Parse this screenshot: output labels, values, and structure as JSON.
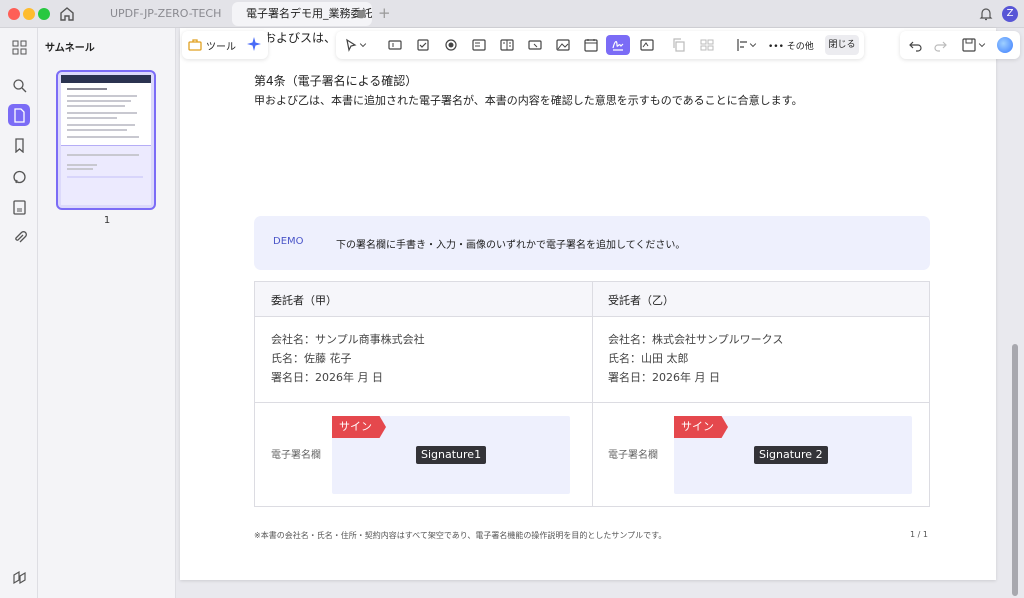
{
  "window": {
    "tabs": [
      {
        "label": "UPDF-JP-ZERO-TECH"
      },
      {
        "label": "電子署名デモ用_業務委託契約"
      }
    ],
    "avatar_initial": "Z"
  },
  "sidebar": {
    "panel_title": "サムネール",
    "thumbnail_page_number": "1"
  },
  "toolbar": {
    "tool_label": "ツール",
    "more_label": "その他",
    "close_label": "閉じる"
  },
  "document": {
    "clipped_heading": "およびスは、本",
    "article_title": "第4条（電子署名による確認）",
    "article_body": "甲および乙は、本書に追加された電子署名が、本書の内容を確認した意思を示すものであることに合意します。",
    "demo_label": "DEMO",
    "demo_text": "下の署名欄に手書き・入力・画像のいずれかで電子署名を追加してください。",
    "parties": [
      {
        "heading": "委託者（甲）",
        "company": "会社名：サンプル商事株式会社",
        "name": "氏名：佐藤 花子",
        "date": "署名日：2026年 月 日",
        "sig_label": "電子署名欄",
        "sign_tag": "サイン",
        "signature": "Signature1"
      },
      {
        "heading": "受託者（乙）",
        "company": "会社名：株式会社サンプルワークス",
        "name": "氏名：山田 太郎",
        "date": "署名日：2026年 月 日",
        "sig_label": "電子署名欄",
        "sign_tag": "サイン",
        "signature": "Signature 2"
      }
    ],
    "footnote": "※本書の会社名・氏名・住所・契約内容はすべて架空であり、電子署名機能の操作説明を目的としたサンプルです。",
    "page_indicator": "1 / 1"
  },
  "colors": {
    "accent": "#7b6cf6",
    "sign_tag": "#e5484d",
    "demo_bg": "#eef0fd"
  }
}
